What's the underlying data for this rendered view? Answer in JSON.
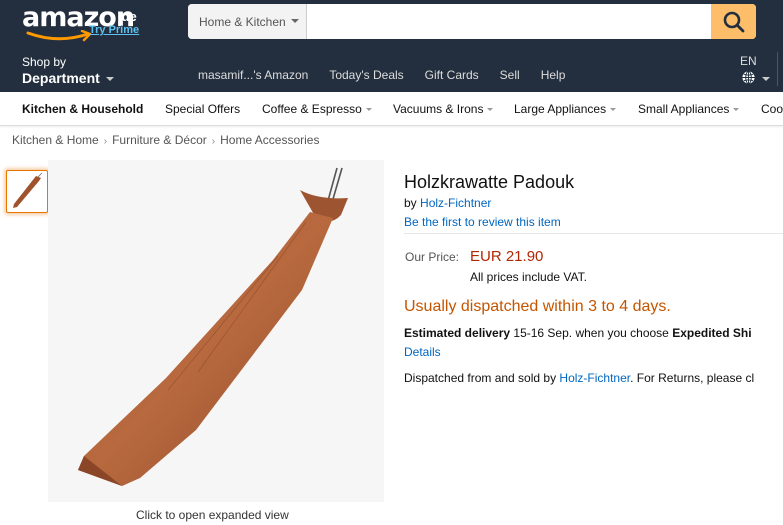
{
  "header": {
    "logo_text": "amazon",
    "logo_tld": ".de",
    "logo_prime": "Try Prime",
    "search_category": "Home & Kitchen",
    "search_value": "",
    "search_icon": "search-icon",
    "shop_by_line1": "Shop by",
    "shop_by_line2": "Department",
    "nav_links": [
      "masamif...'s Amazon",
      "Today's Deals",
      "Gift Cards",
      "Sell",
      "Help"
    ],
    "language": "EN",
    "globe_icon": "globe-icon",
    "colors": {
      "bar": "#232f3e",
      "search_button": "#febd69",
      "logo_prime": "#5ec0f0"
    }
  },
  "subnav": {
    "items": [
      {
        "label": "Kitchen & Household"
      },
      {
        "label": "Special Offers"
      },
      {
        "label": "Coffee & Espresso"
      },
      {
        "label": "Vacuums & Irons"
      },
      {
        "label": "Large Appliances"
      },
      {
        "label": "Small Appliances"
      },
      {
        "label": "Coo"
      }
    ]
  },
  "breadcrumb": [
    "Kitchen & Home",
    "Furniture & Décor",
    "Home Accessories"
  ],
  "gallery": {
    "caption": "Click to open expanded view"
  },
  "product": {
    "title": "Holzkrawatte Padouk",
    "by_prefix": "by",
    "brand": "Holz-Fichtner",
    "review_link": "Be the first to review this item",
    "price_label": "Our Price:",
    "price": "EUR 21.90",
    "vat_note": "All prices include VAT.",
    "availability": "Usually dispatched within 3 to 4 days.",
    "delivery_label": "Estimated delivery",
    "delivery_text": " 15-16 Sep. when you choose ",
    "delivery_option": "Expedited Shi",
    "details_link": "Details",
    "sold_prefix": "Dispatched from and sold by ",
    "seller": "Holz-Fichtner",
    "sold_suffix": ". For Returns, please cl",
    "colors": {
      "price": "#b12704",
      "availability": "#c45500",
      "link": "#0066c0"
    }
  }
}
